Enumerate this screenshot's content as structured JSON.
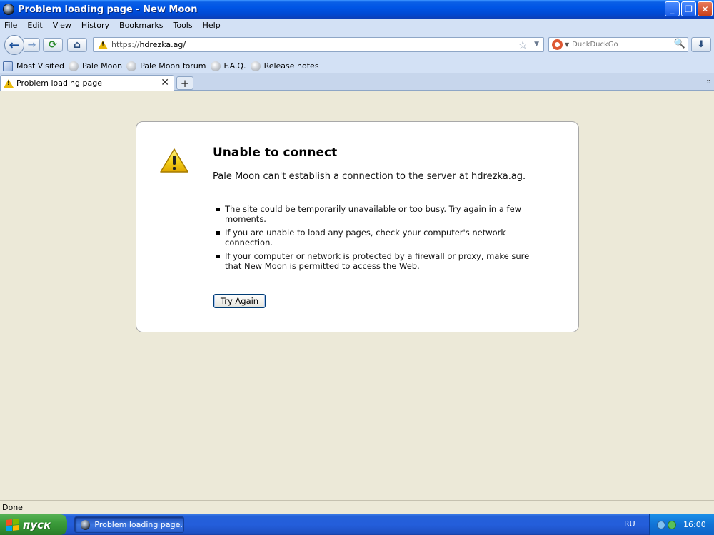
{
  "window": {
    "title": "Problem loading page - New Moon",
    "buttons": {
      "minimize": "_",
      "restore": "❐",
      "close": "✕"
    }
  },
  "menu": [
    "File",
    "Edit",
    "View",
    "History",
    "Bookmarks",
    "Tools",
    "Help"
  ],
  "navbar": {
    "url_scheme": "https://",
    "url_host": "hdrezka.ag/",
    "search_placeholder": "DuckDuckGo",
    "icons": {
      "back": "←",
      "forward": "→",
      "reload": "⟳",
      "home": "⌂",
      "star": "☆",
      "dropdown": "▼",
      "search": "🔍",
      "download": "⬇"
    }
  },
  "bookmarks": [
    "Most Visited",
    "Pale Moon",
    "Pale Moon forum",
    "F.A.Q.",
    "Release notes"
  ],
  "tabs": [
    {
      "label": "Problem loading page",
      "close": "✕"
    }
  ],
  "tabstrip": {
    "new_tab": "+",
    "list_all": "::"
  },
  "error": {
    "title": "Unable to connect",
    "description": "Pale Moon can't establish a connection to the server at hdrezka.ag.",
    "items": [
      "The site could be temporarily unavailable or too busy. Try again in a few moments.",
      "If you are unable to load any pages, check your computer's network connection.",
      "If your computer or network is protected by a firewall or proxy, make sure that New Moon is permitted to access the Web."
    ],
    "button": "Try Again"
  },
  "status": {
    "text": "Done"
  },
  "taskbar": {
    "start_label": "пуск",
    "task_label": "Problem loading page...",
    "lang": "RU",
    "clock": "16:00"
  },
  "colors": {
    "titlebar": "#0055e5",
    "toolbar": "#d3e1f5",
    "content_bg": "#ece9d8",
    "warning": "#e9b90a"
  }
}
